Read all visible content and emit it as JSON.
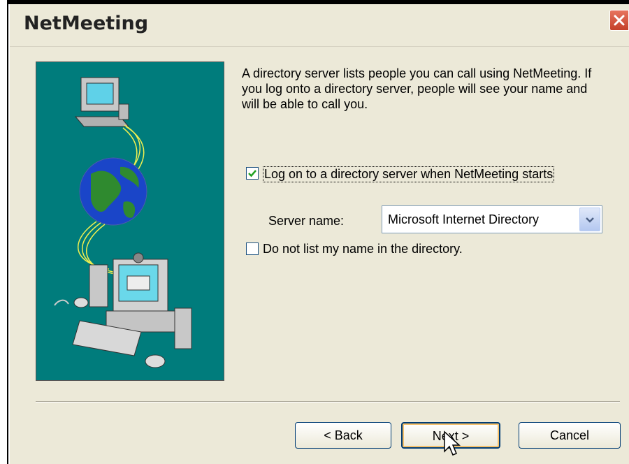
{
  "window": {
    "title": "NetMeeting"
  },
  "description": "A directory server lists people you can call using NetMeeting. If you log onto a directory server, people will see your name and will be able to call you.",
  "options": {
    "logon_checkbox": {
      "label": "Log on to a directory server when NetMeeting starts",
      "checked": true
    },
    "server_name": {
      "label": "Server name:",
      "value": "Microsoft Internet Directory"
    },
    "unlisted_checkbox": {
      "label": "Do not list my name in the directory.",
      "checked": false
    }
  },
  "buttons": {
    "back": "< Back",
    "next": "Next >",
    "cancel": "Cancel"
  },
  "colors": {
    "illustration_bg": "#007C7C",
    "dialog_bg": "#ECE9D8",
    "close_button": "#D0573F"
  },
  "icons": [
    "close-icon",
    "checkmark-icon",
    "chevron-down-icon",
    "computer-icon",
    "globe-icon",
    "mouse-cursor-icon"
  ]
}
